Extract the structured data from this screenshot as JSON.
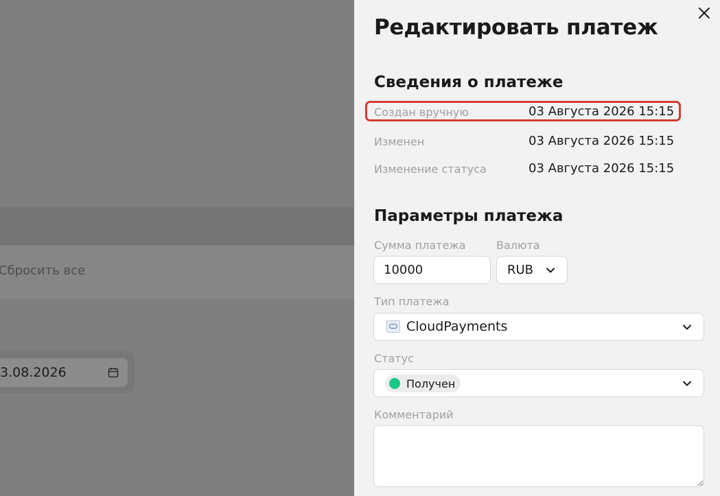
{
  "background": {
    "reset_all": "Сбросить все",
    "date_value": "3.08.2026"
  },
  "drawer": {
    "title": "Редактировать платеж",
    "info_section": {
      "title": "Сведения о платеже",
      "rows": [
        {
          "label": "Создан вручную",
          "value": "03 Августа 2026 15:15"
        },
        {
          "label": "Изменен",
          "value": "03 Августа 2026 15:15"
        },
        {
          "label": "Изменение статуса",
          "value": "03 Августа 2026 15:15"
        }
      ]
    },
    "params_section": {
      "title": "Параметры платежа",
      "amount": {
        "label": "Сумма платежа",
        "value": "10000"
      },
      "currency": {
        "label": "Валюта",
        "value": "RUB"
      },
      "payment_type": {
        "label": "Тип платежа",
        "value": "CloudPayments"
      },
      "status": {
        "label": "Статус",
        "value": "Получен",
        "color": "#17c986"
      },
      "comment": {
        "label": "Комментарий",
        "value": ""
      }
    }
  },
  "colors": {
    "overlay": "#7f7f7f",
    "drawer_bg": "#f2f2f2",
    "highlight": "#d63b32",
    "status_received": "#17c986"
  }
}
